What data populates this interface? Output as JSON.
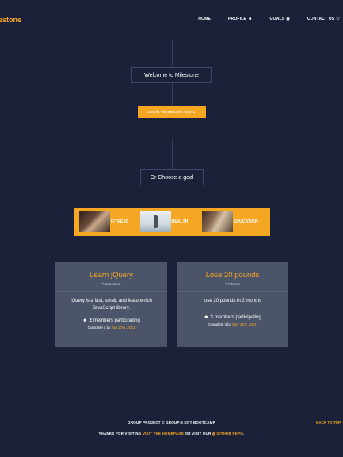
{
  "header": {
    "brand": "estone",
    "nav": [
      {
        "label": "HOME",
        "icon": ""
      },
      {
        "label": "PROFILE",
        "icon": "☻"
      },
      {
        "label": "GOALS",
        "icon": "◉"
      },
      {
        "label": "CONTACT US",
        "icon": "♡"
      }
    ]
  },
  "welcome": "Welcome to Milestone",
  "login_button": "LOGIN TO CREATE GOAL!",
  "choose": "Or Choose a goal",
  "categories": [
    {
      "label": "FITNESS"
    },
    {
      "label": "HEALTH"
    },
    {
      "label": "EDUCATION"
    }
  ],
  "cards": [
    {
      "title": "Learn jQuery",
      "category": "✎Education",
      "description": "jQuery is a fast, small, and feature-rich JavaScript library.",
      "members_count": "2",
      "members_text": "members participating",
      "complete_prefix": "Complete it by",
      "complete_date": "Jun 27th, 2021"
    },
    {
      "title": "Lose 20 pounds",
      "category": "✎Fitness",
      "description": "lose 20 pounds in 2 months",
      "members_count": "3",
      "members_text": "members participating",
      "complete_prefix": "Complete it by",
      "complete_date": "May 31st, 2021"
    }
  ],
  "footer": {
    "line1": "GROUP PROJECT © GROUP-4 UOT BOOTCAMP",
    "back_to_top": "BACK TO TOP",
    "thanks": "THANKS FOR VISITING",
    "homepage_link": "VISIT THE HOMEPAGE",
    "or_visit": "OR VISIT OUR",
    "repo_link": "GITHUB REPO",
    "end": "."
  },
  "colors": {
    "background": "#1b2139",
    "accent": "#f5a623",
    "card": "#4b5468"
  }
}
